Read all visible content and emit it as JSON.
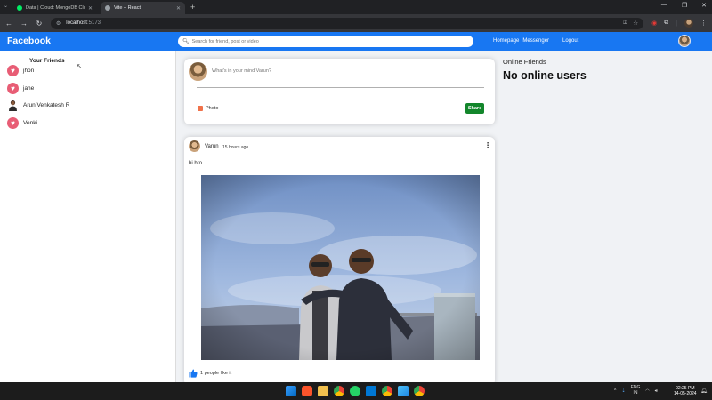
{
  "browser": {
    "tabs": [
      {
        "title": "Data | Cloud: MongoDB Cloud",
        "active": false,
        "favicon_color": "#00ed64"
      },
      {
        "title": "Vite + React",
        "active": true,
        "favicon_color": "#9aa0a6"
      }
    ],
    "url_host": "localhost",
    "url_port": ":5173"
  },
  "topbar": {
    "logo": "Facebook",
    "search_placeholder": "Search for friend, post or video",
    "links": [
      "Homepage",
      "Messenger"
    ],
    "logout": "Logout",
    "color": "#1877f2"
  },
  "sidebar": {
    "title": "Your Friends",
    "friends": [
      {
        "name": "jhon",
        "icon": "heart-icon"
      },
      {
        "name": "jane",
        "icon": "heart-icon"
      },
      {
        "name": "Arun Venkatesh R",
        "icon": "person-avatar"
      },
      {
        "name": "Venki",
        "icon": "heart-icon"
      }
    ]
  },
  "share": {
    "placeholder": "What's in your mind Varun?",
    "photo_label": "Photo",
    "share_label": "Share",
    "share_color": "#12862b"
  },
  "post": {
    "username": "Varun",
    "time": "15 hours ago",
    "text": "hi bro",
    "likes": "1 people like it"
  },
  "right_panel": {
    "title": "Online Friends",
    "empty": "No online users"
  },
  "taskbar": {
    "lang_top": "ENG",
    "lang_bottom": "IN",
    "time": "02:25 PM",
    "date": "14-05-2024"
  }
}
